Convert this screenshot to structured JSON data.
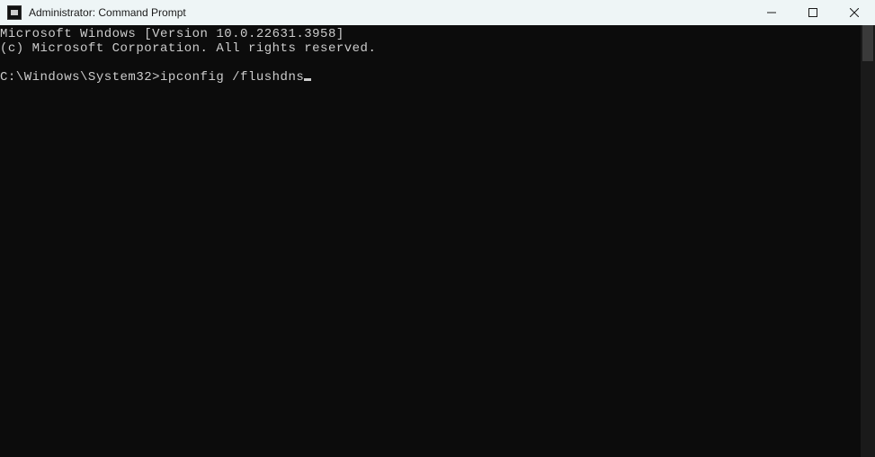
{
  "window": {
    "title": "Administrator: Command Prompt"
  },
  "terminal": {
    "line1": "Microsoft Windows [Version 10.0.22631.3958]",
    "line2": "(c) Microsoft Corporation. All rights reserved.",
    "prompt": "C:\\Windows\\System32>",
    "command": "ipconfig /flushdns"
  }
}
